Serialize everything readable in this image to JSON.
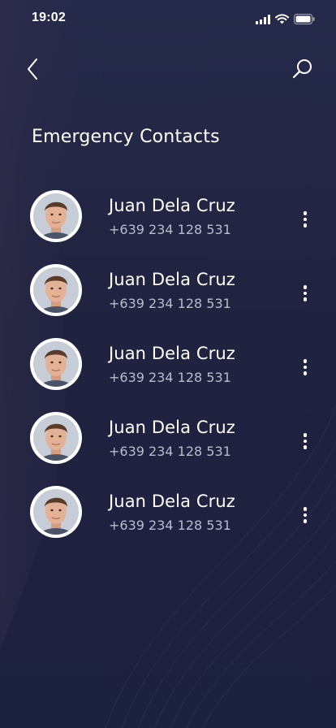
{
  "status_bar": {
    "time": "19:02"
  },
  "nav": {
    "back_icon": "chevron-left-icon",
    "search_icon": "search-icon"
  },
  "page": {
    "title": "Emergency Contacts"
  },
  "contacts": [
    {
      "name": "Juan Dela Cruz",
      "phone": "+639 234 128 531"
    },
    {
      "name": "Juan Dela Cruz",
      "phone": "+639 234 128 531"
    },
    {
      "name": "Juan Dela Cruz",
      "phone": "+639 234 128 531"
    },
    {
      "name": "Juan Dela Cruz",
      "phone": "+639 234 128 531"
    },
    {
      "name": "Juan Dela Cruz",
      "phone": "+639 234 128 531"
    }
  ],
  "colors": {
    "background": "#1f2340",
    "text_primary": "#ffffff",
    "text_secondary": "#b9bcc9"
  }
}
